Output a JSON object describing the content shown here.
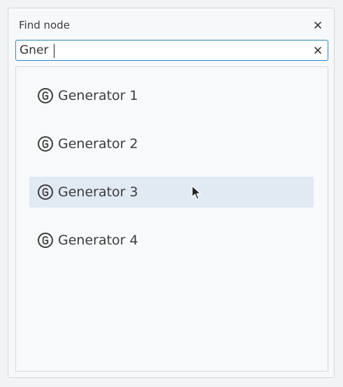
{
  "dialog": {
    "title": "Find node",
    "close_icon": "close-icon"
  },
  "search": {
    "value": "Gner",
    "clear_icon": "clear-icon"
  },
  "results": {
    "items": [
      {
        "label": "Generator 1",
        "icon": "generator-icon",
        "highlighted": false
      },
      {
        "label": "Generator 2",
        "icon": "generator-icon",
        "highlighted": false
      },
      {
        "label": "Generator 3",
        "icon": "generator-icon",
        "highlighted": true
      },
      {
        "label": "Generator 4",
        "icon": "generator-icon",
        "highlighted": false
      }
    ]
  },
  "colors": {
    "accent": "#2c87c2",
    "highlight": "#e1e9f3"
  }
}
